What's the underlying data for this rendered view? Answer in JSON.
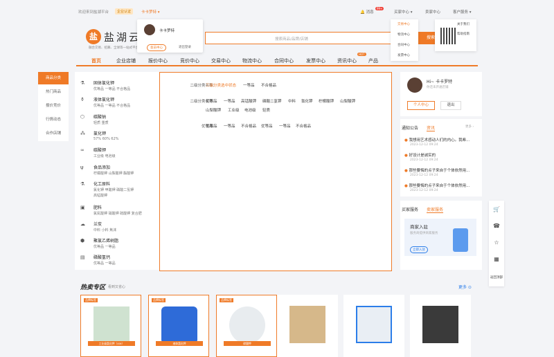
{
  "topbar": {
    "welcome": "欢迎来到盐湖平台",
    "badge": "企业认证",
    "user": "卡卡罗特",
    "message": "消息",
    "message_count": "99+",
    "buyer_center": "买家中心",
    "seller_center": "卖家中心",
    "customer_service": "客户服务"
  },
  "logo": {
    "mark": "盐",
    "name": "盐湖云",
    "slogan": "融合交易、招募、全球等一站式平台"
  },
  "search": {
    "placeholder": "搜索商品/品牌/店铺",
    "button": "搜索"
  },
  "nav": [
    {
      "label": "首页"
    },
    {
      "label": "企业店铺"
    },
    {
      "label": "报价中心"
    },
    {
      "label": "竞价中心"
    },
    {
      "label": "交易中心"
    },
    {
      "label": "物流中心"
    },
    {
      "label": "合同中心"
    },
    {
      "label": "发票中心"
    },
    {
      "label": "资讯中心"
    },
    {
      "label": "产品"
    }
  ],
  "nav_hot": "HOT",
  "user_popup": {
    "name": "卡卡罗特",
    "center": "会员中心",
    "logout": "退出登录"
  },
  "service_popup": [
    "交易中心",
    "物流中心",
    "合同中心",
    "发票中心"
  ],
  "qr_popup": [
    "关于我们",
    "帮助指南"
  ],
  "sidebar": [
    "商品分类",
    "热门商品",
    "报价竞价",
    "行情动态",
    "合作店铺"
  ],
  "categories": [
    {
      "icon": "⚗",
      "name": "固体氯化钾",
      "subs": "优等品    一等品    不合格品"
    },
    {
      "icon": "⚱",
      "name": "液体氯化钾",
      "subs": "优等品    一等品    不合格品"
    },
    {
      "icon": "⬡",
      "name": "碳酸钠",
      "subs": "轻质    重质"
    },
    {
      "icon": "⁂",
      "name": "氯化钾",
      "subs": "57%    60%    62%"
    },
    {
      "icon": "∞",
      "name": "碳酸钾",
      "subs": "工业级    电池级"
    },
    {
      "icon": "ψ",
      "name": "食品添加",
      "subs": "柠檬酸钾    山梨酸钾    酯酸钾"
    },
    {
      "icon": "⚗",
      "name": "化工原料",
      "subs": "氯化钾    甲酸钾    磷酸二氢钾",
      "subs2": "高锰酸钾"
    },
    {
      "icon": "▣",
      "name": "肥料",
      "subs": "氯氮酸钾    硝酸钾    硫酸钾    复合肥"
    },
    {
      "icon": "☁",
      "name": "兰炭",
      "subs": "中料    小料    焦沫"
    },
    {
      "icon": "⬢",
      "name": "聚氯乙烯树脂",
      "subs": "优等品    一等品"
    },
    {
      "icon": "▤",
      "name": "磷酸氢钙",
      "subs": "优等品    一等品"
    }
  ],
  "sub_panel": {
    "row1_label": "二级分类名称：",
    "row1": [
      "三级分类选中状态",
      "一等品",
      "不合格品"
    ],
    "row2_label": "二级分类名称：",
    "row2a": [
      "优等品",
      "一等品",
      "高锰酸钾",
      "磷酸二氢钾",
      "中料",
      "氯化钾",
      "柠檬酸钾",
      "山梨酸钾"
    ],
    "row2b": [
      "山梨酸钾",
      "工业级",
      "电池级",
      "轻质"
    ],
    "row3_label": "优等品：",
    "row3": [
      "优等品",
      "一等品",
      "不合格品",
      "优等品",
      "一等品",
      "不合格品"
    ]
  },
  "user_card": {
    "greeting": "Hi~ 卡卡罗特",
    "sub": "你还未开通店铺",
    "center": "个人中心",
    "logout": "退出"
  },
  "notice": {
    "tab1": "通知公告",
    "tab2": "资讯",
    "more": "更多 ›",
    "items": [
      {
        "title": "我想用艺术感动人们的内心。我希...",
        "date": "2023-12-12 09:24"
      },
      {
        "title": "好设计是诚实的",
        "date": "2023-12-12 09:24"
      },
      {
        "title": "那些要悔的点子来自于个体依然用...",
        "date": "2023-12-12 09:24"
      },
      {
        "title": "那些要悔的点子来自于个体依然用...",
        "date": "2023-12-12 09:24"
      }
    ]
  },
  "services": {
    "tab1": "买家服务",
    "tab2": "卖家服务",
    "title": "商家入驻",
    "sub": "服务商提供商家服务",
    "btn": "立即入驻"
  },
  "float_bar": {
    "text": "返回顶部"
  },
  "hot": {
    "title": "热卖专区",
    "sub": "看到又省心",
    "more": "更多",
    "products": [
      {
        "badge": "品牌标签",
        "cap": "工业级氯化钾（40t）"
      },
      {
        "badge": "品牌标签",
        "cap": "液体氯化钾"
      },
      {
        "badge": "品牌标签",
        "cap": "碳酸钾"
      },
      {
        "badge": "",
        "cap": ""
      },
      {
        "badge": "",
        "cap": ""
      },
      {
        "badge": "",
        "cap": ""
      }
    ]
  }
}
